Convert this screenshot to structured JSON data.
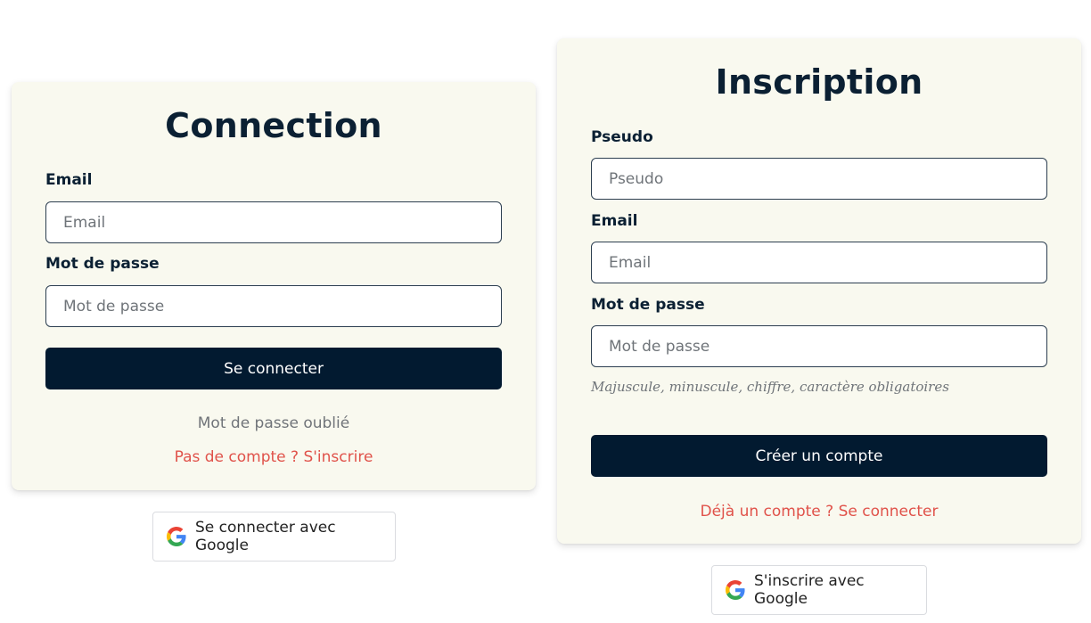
{
  "login": {
    "title": "Connection",
    "email": {
      "label": "Email",
      "placeholder": "Email",
      "value": ""
    },
    "password": {
      "label": "Mot de passe",
      "placeholder": "Mot de passe",
      "value": ""
    },
    "submit_label": "Se connecter",
    "forgot_link": "Mot de passe oublié",
    "signup_link": "Pas de compte ? S'inscrire",
    "google_label": "Se connecter avec Google"
  },
  "signup": {
    "title": "Inscription",
    "pseudo": {
      "label": "Pseudo",
      "placeholder": "Pseudo",
      "value": ""
    },
    "email": {
      "label": "Email",
      "placeholder": "Email",
      "value": ""
    },
    "password": {
      "label": "Mot de passe",
      "placeholder": "Mot de passe",
      "value": ""
    },
    "password_hint": "Majuscule, minuscule, chiffre, caractère obligatoires",
    "submit_label": "Créer un compte",
    "login_link": "Déjà un compte ? Se connecter",
    "google_label": "S'inscrire avec Google"
  },
  "icons": {
    "google": "google-g-icon"
  },
  "colors": {
    "card_bg": "#f9f9ef",
    "primary": "#021a30",
    "heading": "#0b2033",
    "link_red": "#e0524a",
    "link_grey": "#707479"
  }
}
